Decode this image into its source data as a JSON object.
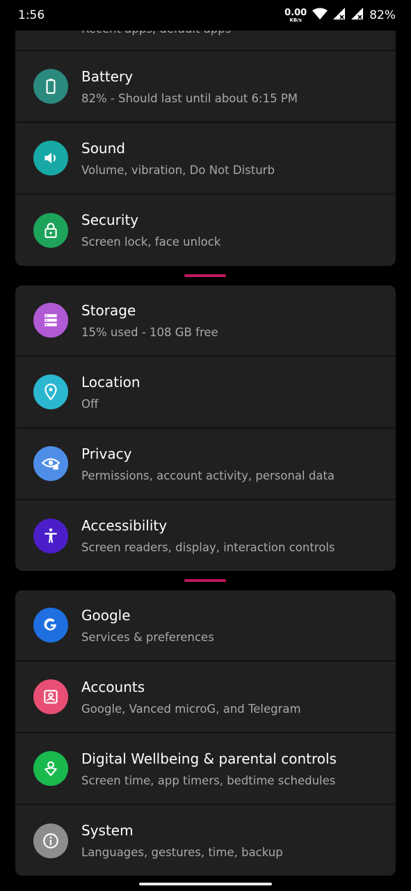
{
  "status_bar": {
    "time": "1:56",
    "net_speed": "0.00",
    "net_unit": "KB/s",
    "battery": "82%"
  },
  "colors": {
    "accent_divider": "#c2185b",
    "card_bg": "#202020"
  },
  "partial_item": {
    "subtitle": "Recent apps, default apps"
  },
  "group1": [
    {
      "title": "Battery",
      "subtitle": "82% - Should last until about 6:15 PM",
      "icon": "battery-icon",
      "color": "#2b8a7e"
    },
    {
      "title": "Sound",
      "subtitle": "Volume, vibration, Do Not Disturb",
      "icon": "volume-icon",
      "color": "#18a8a5"
    },
    {
      "title": "Security",
      "subtitle": "Screen lock, face unlock",
      "icon": "lock-icon",
      "color": "#1ea35a"
    }
  ],
  "group2": [
    {
      "title": "Storage",
      "subtitle": "15% used - 108 GB free",
      "icon": "storage-icon",
      "color": "#b15ad6"
    },
    {
      "title": "Location",
      "subtitle": "Off",
      "icon": "location-pin-icon",
      "color": "#2bb7d0"
    },
    {
      "title": "Privacy",
      "subtitle": "Permissions, account activity, personal data",
      "icon": "privacy-eye-icon",
      "color": "#4f8ee8"
    },
    {
      "title": "Accessibility",
      "subtitle": "Screen readers, display, interaction controls",
      "icon": "accessibility-icon",
      "color": "#4a1fc9"
    }
  ],
  "group3": [
    {
      "title": "Google",
      "subtitle": "Services & preferences",
      "icon": "google-icon",
      "color": "#1f6fe0"
    },
    {
      "title": "Accounts",
      "subtitle": "Google, Vanced microG, and Telegram",
      "icon": "account-icon",
      "color": "#e94f74"
    },
    {
      "title": "Digital Wellbeing & parental controls",
      "subtitle": "Screen time, app timers, bedtime schedules",
      "icon": "wellbeing-icon",
      "color": "#19b94e"
    },
    {
      "title": "System",
      "subtitle": "Languages, gestures, time, backup",
      "icon": "info-icon",
      "color": "#8d8d8d"
    }
  ]
}
